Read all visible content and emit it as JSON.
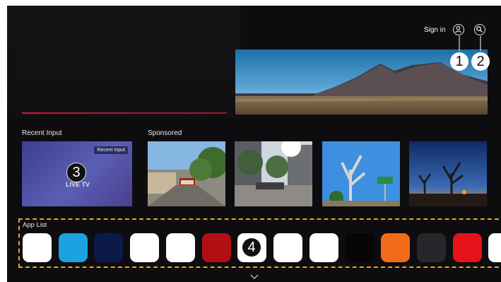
{
  "header": {
    "sign_in_label": "Sign in",
    "profile_icon": "person-icon",
    "search_icon": "search-icon"
  },
  "callouts": {
    "profile": "1",
    "search": "2",
    "recent_input": "3",
    "app_list": "4"
  },
  "sections": {
    "recent_input_title": "Recent Input",
    "sponsored_title": "Sponsored",
    "app_list_title": "App List"
  },
  "recent_input_tile": {
    "badge": "Recent Input",
    "label": "LIVE TV"
  },
  "app_list": {
    "apps": [
      {
        "color": "#ffffff"
      },
      {
        "color": "#1aa3e0"
      },
      {
        "color": "#0c1a4a"
      },
      {
        "color": "#ffffff"
      },
      {
        "color": "#ffffff"
      },
      {
        "color": "#b10f14"
      },
      {
        "color": "#ffffff"
      },
      {
        "color": "#ffffff"
      },
      {
        "color": "#ffffff"
      },
      {
        "color": "#050505"
      },
      {
        "color": "#f26b1d"
      },
      {
        "color": "#26272b"
      },
      {
        "color": "#e5141a"
      },
      {
        "color": "#ffffff"
      }
    ],
    "scroll_icon": "chevron-down-icon"
  },
  "colors": {
    "accent_line": "#c8133a",
    "highlight_border": "#e8a430",
    "background": "#0d0d0f"
  }
}
